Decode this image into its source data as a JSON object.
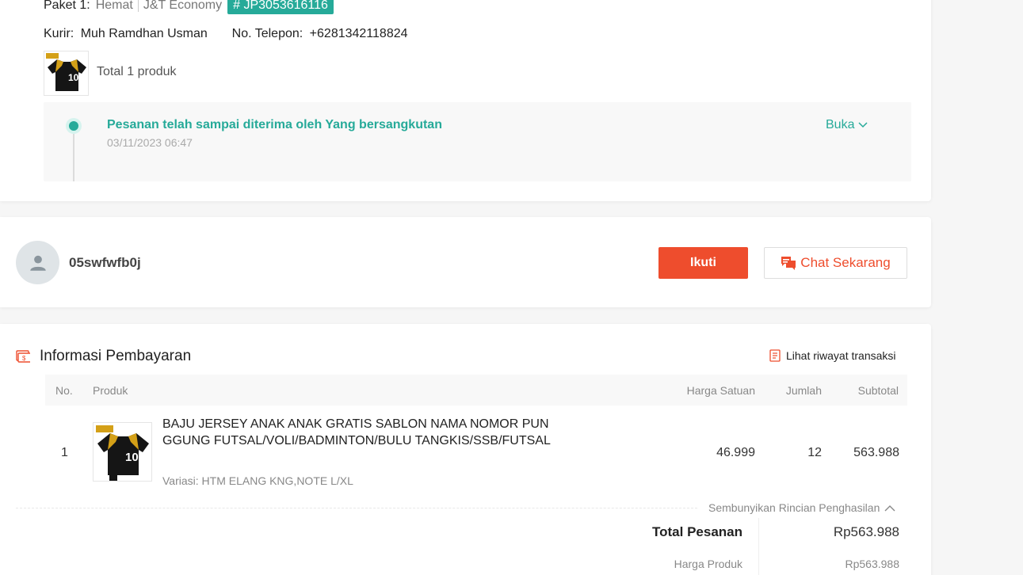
{
  "shipment": {
    "paket_label": "Paket 1:",
    "service": "Hemat",
    "courier_company": "J&T Economy",
    "tracking": "# JP3053616116",
    "kurir_label": "Kurir:",
    "kurir_name": "Muh Ramdhan Usman",
    "phone_label": "No. Telepon:",
    "phone": "+6281342118824",
    "total_products": "Total 1 produk",
    "status": "Pesanan telah sampai diterima oleh Yang bersangkutan",
    "status_time": "03/11/2023 06:47",
    "expand_label": "Buka"
  },
  "seller": {
    "username": "05swfwfb0j",
    "follow_label": "Ikuti",
    "chat_label": "Chat Sekarang"
  },
  "payment": {
    "title": "Informasi Pembayaran",
    "history_link": "Lihat riwayat transaksi",
    "columns": {
      "no": "No.",
      "product": "Produk",
      "unit_price": "Harga Satuan",
      "qty": "Jumlah",
      "subtotal": "Subtotal"
    },
    "items": [
      {
        "no": "1",
        "name": "BAJU JERSEY ANAK ANAK GRATIS SABLON NAMA NOMOR PUNGGUNG FUTSAL/VOLI/BADMINTON/BULU TANGKIS/SSB/FUTSAL",
        "variant": "Variasi: HTM ELANG KNG,NOTE L/XL",
        "unit_price": "46.999",
        "qty": "12",
        "subtotal": "563.988"
      }
    ],
    "hide_details": "Sembunyikan Rincian Penghasilan",
    "total_label": "Total Pesanan",
    "total_value": "Rp563.988",
    "product_price_label": "Harga Produk",
    "product_price_value": "Rp563.988"
  },
  "colors": {
    "accent": "#26aa99",
    "primary": "#ee4d2d"
  },
  "icons": {
    "chevron_down": "chevron-down-icon",
    "chat": "chat-icon",
    "payment": "payment-icon",
    "history": "receipt-icon",
    "avatar": "user-icon",
    "chevron_up": "chevron-up-icon"
  }
}
